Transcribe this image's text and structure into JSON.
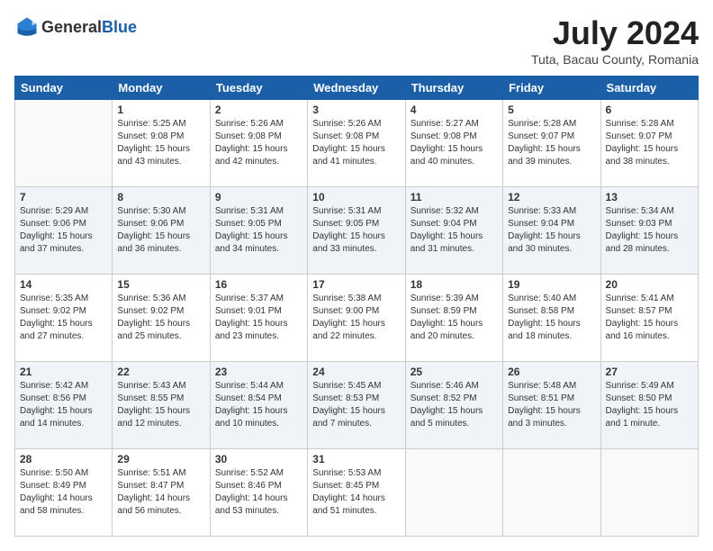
{
  "header": {
    "logo_general": "General",
    "logo_blue": "Blue",
    "month_year": "July 2024",
    "location": "Tuta, Bacau County, Romania"
  },
  "weekdays": [
    "Sunday",
    "Monday",
    "Tuesday",
    "Wednesday",
    "Thursday",
    "Friday",
    "Saturday"
  ],
  "weeks": [
    [
      {
        "day": "",
        "text": ""
      },
      {
        "day": "1",
        "text": "Sunrise: 5:25 AM\nSunset: 9:08 PM\nDaylight: 15 hours\nand 43 minutes."
      },
      {
        "day": "2",
        "text": "Sunrise: 5:26 AM\nSunset: 9:08 PM\nDaylight: 15 hours\nand 42 minutes."
      },
      {
        "day": "3",
        "text": "Sunrise: 5:26 AM\nSunset: 9:08 PM\nDaylight: 15 hours\nand 41 minutes."
      },
      {
        "day": "4",
        "text": "Sunrise: 5:27 AM\nSunset: 9:08 PM\nDaylight: 15 hours\nand 40 minutes."
      },
      {
        "day": "5",
        "text": "Sunrise: 5:28 AM\nSunset: 9:07 PM\nDaylight: 15 hours\nand 39 minutes."
      },
      {
        "day": "6",
        "text": "Sunrise: 5:28 AM\nSunset: 9:07 PM\nDaylight: 15 hours\nand 38 minutes."
      }
    ],
    [
      {
        "day": "7",
        "text": "Sunrise: 5:29 AM\nSunset: 9:06 PM\nDaylight: 15 hours\nand 37 minutes."
      },
      {
        "day": "8",
        "text": "Sunrise: 5:30 AM\nSunset: 9:06 PM\nDaylight: 15 hours\nand 36 minutes."
      },
      {
        "day": "9",
        "text": "Sunrise: 5:31 AM\nSunset: 9:05 PM\nDaylight: 15 hours\nand 34 minutes."
      },
      {
        "day": "10",
        "text": "Sunrise: 5:31 AM\nSunset: 9:05 PM\nDaylight: 15 hours\nand 33 minutes."
      },
      {
        "day": "11",
        "text": "Sunrise: 5:32 AM\nSunset: 9:04 PM\nDaylight: 15 hours\nand 31 minutes."
      },
      {
        "day": "12",
        "text": "Sunrise: 5:33 AM\nSunset: 9:04 PM\nDaylight: 15 hours\nand 30 minutes."
      },
      {
        "day": "13",
        "text": "Sunrise: 5:34 AM\nSunset: 9:03 PM\nDaylight: 15 hours\nand 28 minutes."
      }
    ],
    [
      {
        "day": "14",
        "text": "Sunrise: 5:35 AM\nSunset: 9:02 PM\nDaylight: 15 hours\nand 27 minutes."
      },
      {
        "day": "15",
        "text": "Sunrise: 5:36 AM\nSunset: 9:02 PM\nDaylight: 15 hours\nand 25 minutes."
      },
      {
        "day": "16",
        "text": "Sunrise: 5:37 AM\nSunset: 9:01 PM\nDaylight: 15 hours\nand 23 minutes."
      },
      {
        "day": "17",
        "text": "Sunrise: 5:38 AM\nSunset: 9:00 PM\nDaylight: 15 hours\nand 22 minutes."
      },
      {
        "day": "18",
        "text": "Sunrise: 5:39 AM\nSunset: 8:59 PM\nDaylight: 15 hours\nand 20 minutes."
      },
      {
        "day": "19",
        "text": "Sunrise: 5:40 AM\nSunset: 8:58 PM\nDaylight: 15 hours\nand 18 minutes."
      },
      {
        "day": "20",
        "text": "Sunrise: 5:41 AM\nSunset: 8:57 PM\nDaylight: 15 hours\nand 16 minutes."
      }
    ],
    [
      {
        "day": "21",
        "text": "Sunrise: 5:42 AM\nSunset: 8:56 PM\nDaylight: 15 hours\nand 14 minutes."
      },
      {
        "day": "22",
        "text": "Sunrise: 5:43 AM\nSunset: 8:55 PM\nDaylight: 15 hours\nand 12 minutes."
      },
      {
        "day": "23",
        "text": "Sunrise: 5:44 AM\nSunset: 8:54 PM\nDaylight: 15 hours\nand 10 minutes."
      },
      {
        "day": "24",
        "text": "Sunrise: 5:45 AM\nSunset: 8:53 PM\nDaylight: 15 hours\nand 7 minutes."
      },
      {
        "day": "25",
        "text": "Sunrise: 5:46 AM\nSunset: 8:52 PM\nDaylight: 15 hours\nand 5 minutes."
      },
      {
        "day": "26",
        "text": "Sunrise: 5:48 AM\nSunset: 8:51 PM\nDaylight: 15 hours\nand 3 minutes."
      },
      {
        "day": "27",
        "text": "Sunrise: 5:49 AM\nSunset: 8:50 PM\nDaylight: 15 hours\nand 1 minute."
      }
    ],
    [
      {
        "day": "28",
        "text": "Sunrise: 5:50 AM\nSunset: 8:49 PM\nDaylight: 14 hours\nand 58 minutes."
      },
      {
        "day": "29",
        "text": "Sunrise: 5:51 AM\nSunset: 8:47 PM\nDaylight: 14 hours\nand 56 minutes."
      },
      {
        "day": "30",
        "text": "Sunrise: 5:52 AM\nSunset: 8:46 PM\nDaylight: 14 hours\nand 53 minutes."
      },
      {
        "day": "31",
        "text": "Sunrise: 5:53 AM\nSunset: 8:45 PM\nDaylight: 14 hours\nand 51 minutes."
      },
      {
        "day": "",
        "text": ""
      },
      {
        "day": "",
        "text": ""
      },
      {
        "day": "",
        "text": ""
      }
    ]
  ]
}
